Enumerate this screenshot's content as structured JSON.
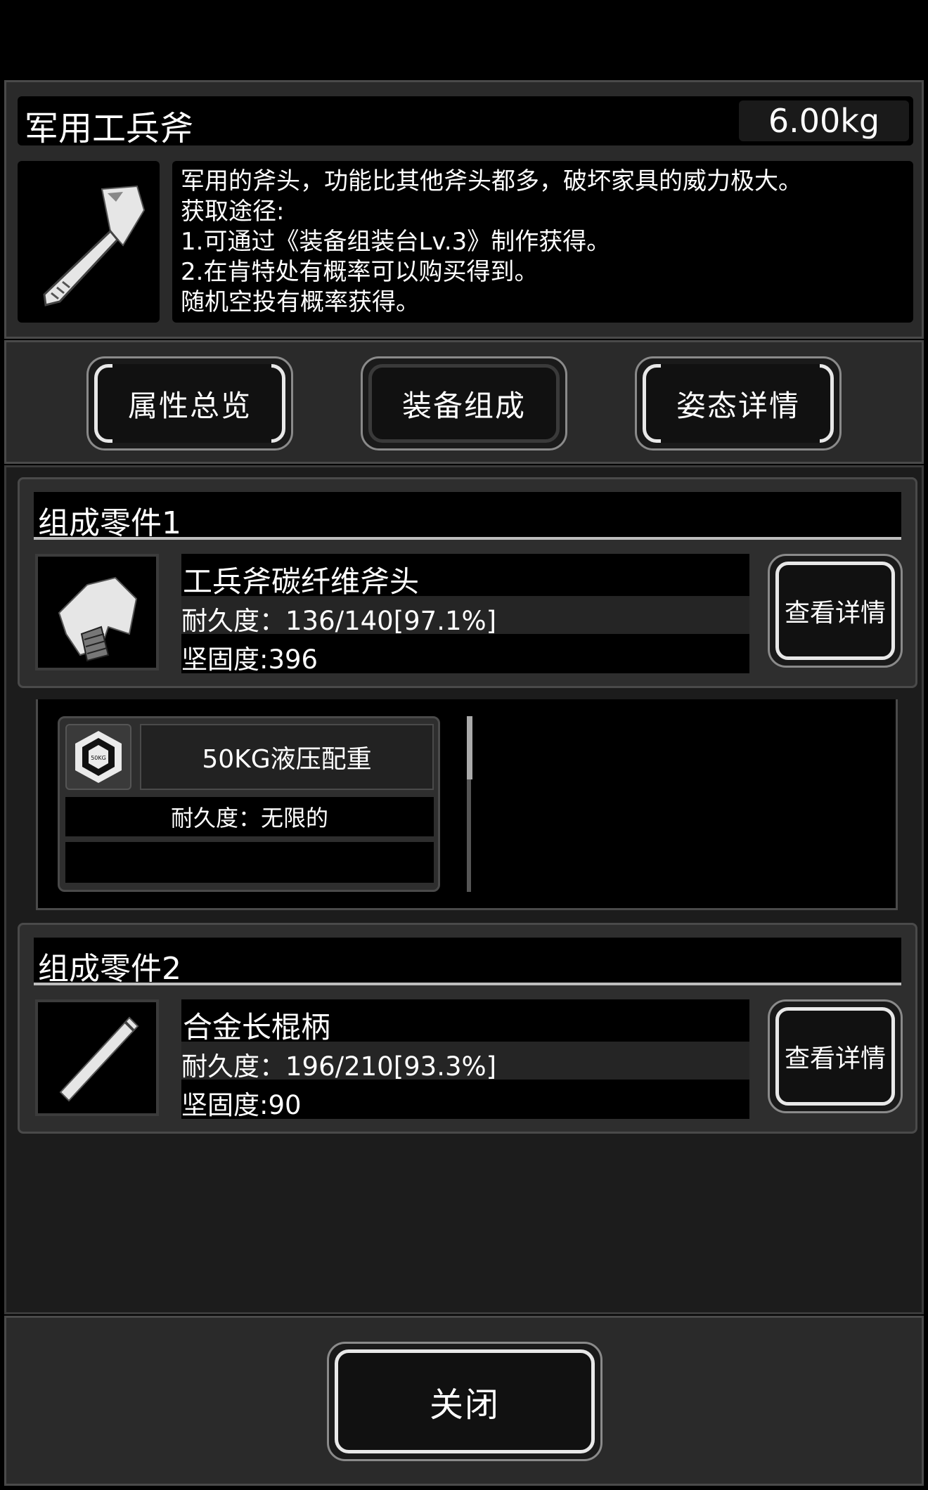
{
  "item": {
    "name": "军用工兵斧",
    "weight": "6.00kg",
    "description": [
      "军用的斧头，功能比其他斧头都多，破坏家具的威力极大。",
      "获取途径:",
      "1.可通过《装备组装台Lv.3》制作获得。",
      "2.在肯特处有概率可以购买得到。",
      "随机空投有概率获得。"
    ]
  },
  "tabs": [
    {
      "label": "属性总览"
    },
    {
      "label": "装备组成",
      "active": true
    },
    {
      "label": "姿态详情"
    }
  ],
  "parts": [
    {
      "header": "组成零件1",
      "name": "工兵斧碳纤维斧头",
      "durability": "耐久度：136/140[97.1%]",
      "hardness": "坚固度:396",
      "button": "查看详情"
    },
    {
      "header": "组成零件2",
      "name": "合金长棍柄",
      "durability": "耐久度：196/210[93.3%]",
      "hardness": "坚固度:90",
      "button": "查看详情"
    }
  ],
  "attachment": {
    "name": "50KG液压配重",
    "durability": "耐久度：无限的",
    "icon_text": "50KG"
  },
  "close_label": "关闭"
}
